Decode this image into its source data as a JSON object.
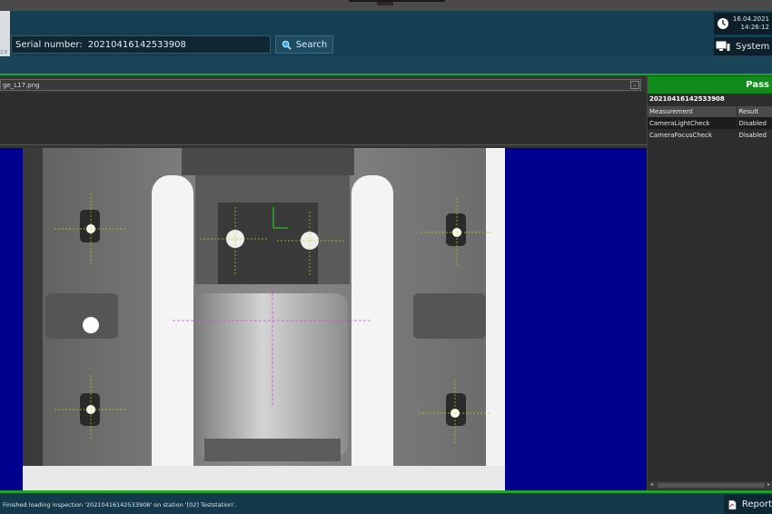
{
  "header": {
    "logo_text": "2.0",
    "serial_label": "Serial number:",
    "serial_value": "20210416142533908",
    "search_label": "Search",
    "clock_date": "16.04.2021",
    "clock_time": "14:26:12",
    "system_label": "System"
  },
  "viewer": {
    "file_name": "ge_L17.png",
    "dropdown_arrow": "⌄"
  },
  "results": {
    "status": "Pass",
    "serial": "20210416142533908",
    "columns": [
      "Measurement",
      "Result"
    ],
    "rows": [
      {
        "measurement": "CameraLightCheck",
        "result": "Disabled"
      },
      {
        "measurement": "CameraFocusCheck",
        "result": "Disabled"
      }
    ],
    "status_color": "#108a1a"
  },
  "statusbar": {
    "message": "Finished loading inspection '20210416142533908' on station '[02] Teststation'.",
    "report_label": "Report"
  },
  "icons": {
    "search": "search-icon",
    "clock": "clock-icon",
    "system": "monitor-icon",
    "report": "pdf-icon"
  }
}
